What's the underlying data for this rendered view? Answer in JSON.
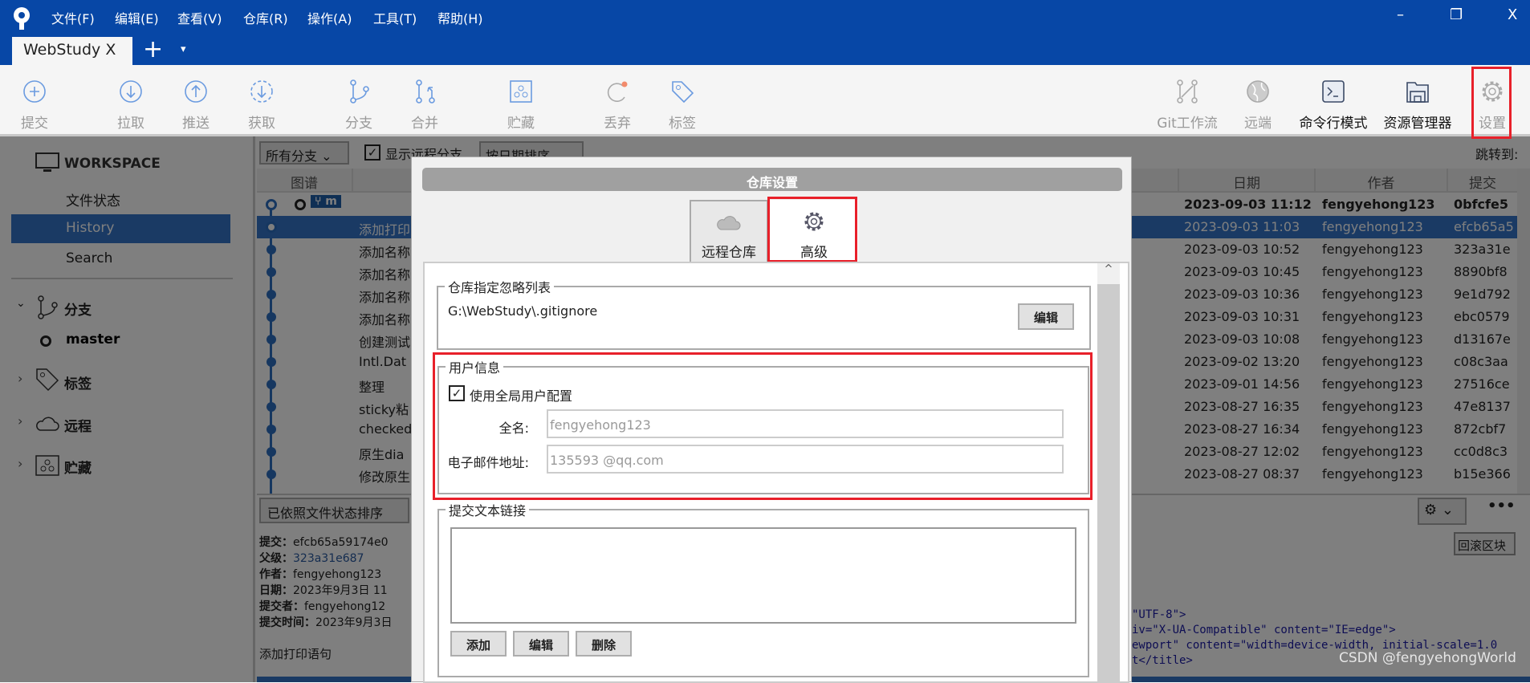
{
  "menu": [
    "文件(F)",
    "编辑(E)",
    "查看(V)",
    "仓库(R)",
    "操作(A)",
    "工具(T)",
    "帮助(H)"
  ],
  "repo_tab": {
    "label": "WebStudy",
    "close": "X",
    "add": "+",
    "more": "▾"
  },
  "window": {
    "minimize": "–",
    "restore": "❐",
    "close": "X"
  },
  "toolbar": {
    "left": [
      {
        "label": "提交",
        "icon": "plus-circle-icon"
      },
      {
        "label": "拉取",
        "icon": "arrow-down-circle-icon"
      },
      {
        "label": "推送",
        "icon": "arrow-up-circle-icon"
      },
      {
        "label": "获取",
        "icon": "fetch-icon"
      },
      {
        "label": "分支",
        "icon": "branch-icon"
      },
      {
        "label": "合并",
        "icon": "merge-icon"
      },
      {
        "label": "贮藏",
        "icon": "stash-icon"
      },
      {
        "label": "丢弃",
        "icon": "discard-icon"
      },
      {
        "label": "标签",
        "icon": "tag-icon"
      }
    ],
    "right": [
      {
        "label": "Git工作流",
        "icon": "git-flow-icon"
      },
      {
        "label": "远端",
        "icon": "globe-icon"
      },
      {
        "label": "命令行模式",
        "icon": "terminal-icon"
      },
      {
        "label": "资源管理器",
        "icon": "folder-icon"
      },
      {
        "label": "设置",
        "icon": "gear-icon"
      }
    ]
  },
  "sidebar": {
    "workspace": "WORKSPACE",
    "items": [
      "文件状态",
      "History",
      "Search"
    ],
    "selected": "History",
    "branches": "分支",
    "master": "master",
    "tags": "标签",
    "remotes": "远程",
    "stashes": "贮藏"
  },
  "filters": {
    "branches": "所有分支",
    "show_remote": "显示远程分支",
    "show_remote_checked": true,
    "sort": "按日期排序",
    "jump": "跳转到:"
  },
  "columns": {
    "graph": "图谱",
    "date": "日期",
    "author": "作者",
    "commit": "提交"
  },
  "commits": [
    {
      "msg": "",
      "date": "2023-09-03 11:12",
      "author": "fengyehong123",
      "hash": "0bfcfe5",
      "branch": "m"
    },
    {
      "msg": "添加打印",
      "date": "2023-09-03 11:03",
      "author": "fengyehong123",
      "hash": "efcb65a5"
    },
    {
      "msg": "添加名称",
      "date": "2023-09-03 10:52",
      "author": "fengyehong123",
      "hash": "323a31e"
    },
    {
      "msg": "添加名称",
      "date": "2023-09-03 10:45",
      "author": "fengyehong123",
      "hash": "8890bf8"
    },
    {
      "msg": "添加名称",
      "date": "2023-09-03 10:36",
      "author": "fengyehong123",
      "hash": "9e1d792"
    },
    {
      "msg": "添加名称",
      "date": "2023-09-03 10:31",
      "author": "fengyehong123",
      "hash": "ebc0579"
    },
    {
      "msg": "创建测试",
      "date": "2023-09-03 10:08",
      "author": "fengyehong123",
      "hash": "d13167e"
    },
    {
      "msg": "Intl.Dat",
      "date": "2023-09-02 13:20",
      "author": "fengyehong123",
      "hash": "c08c3aa"
    },
    {
      "msg": "整理",
      "date": "2023-09-01 14:56",
      "author": "fengyehong123",
      "hash": "27516ce"
    },
    {
      "msg": "sticky粘",
      "date": "2023-08-27 16:35",
      "author": "fengyehong123",
      "hash": "47e8137"
    },
    {
      "msg": "checked",
      "date": "2023-08-27 16:34",
      "author": "fengyehong123",
      "hash": "872cbf7"
    },
    {
      "msg": "原生dia",
      "date": "2023-08-27 12:02",
      "author": "fengyehong123",
      "hash": "cc0d8c3"
    },
    {
      "msg": "修改原生",
      "date": "2023-08-27 08:37",
      "author": "fengyehong123",
      "hash": "b15e366"
    }
  ],
  "bottom": {
    "sort": "已依照文件状态排序",
    "revert_hunk": "回滚区块",
    "details": [
      {
        "k": "提交：",
        "v": "efcb65a59174e0"
      },
      {
        "k": "父级：",
        "v": "323a31e687"
      },
      {
        "k": "作者：",
        "v": "fengyehong123"
      },
      {
        "k": "日期：",
        "v": "2023年9月3日 11"
      },
      {
        "k": "提交者：",
        "v": "fengyehong12"
      },
      {
        "k": "提交时间：",
        "v": "2023年9月3日"
      }
    ],
    "message": "添加打印语句",
    "code": [
      "\"UTF-8\">",
      "iv=\"X-UA-Compatible\" content=\"IE=edge\">",
      "ewport\" content=\"width=device-width, initial-scale=1.0",
      "t</title>"
    ]
  },
  "dialog": {
    "title": "仓库设置",
    "tabs": [
      "远程仓库",
      "高级"
    ],
    "active_tab": "高级",
    "ignore": {
      "legend": "仓库指定忽略列表",
      "path": "G:\\WebStudy\\.gitignore",
      "edit": "编辑"
    },
    "user": {
      "legend": "用户信息",
      "use_global": "使用全局用户配置",
      "use_global_checked": true,
      "name_label": "全名:",
      "name": "fengyehong123",
      "email_label": "电子邮件地址:",
      "email": "135593​  @qq.com"
    },
    "links": {
      "legend": "提交文本链接",
      "add": "添加",
      "edit": "编辑",
      "delete": "删除"
    }
  },
  "watermark": "CSDN @fengyehongWorld",
  "colors": {
    "titlebar": "#0747a6",
    "selection": "#3475c9",
    "highlight": "#e8202a"
  }
}
